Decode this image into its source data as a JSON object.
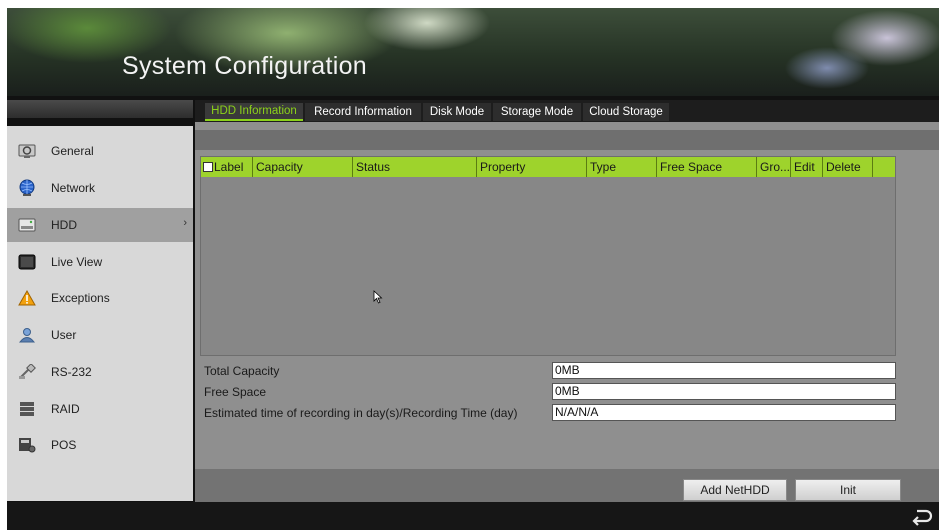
{
  "title": "System Configuration",
  "sidebar": {
    "items": [
      {
        "label": "General",
        "icon": "general-icon"
      },
      {
        "label": "Network",
        "icon": "network-icon"
      },
      {
        "label": "HDD",
        "icon": "hdd-icon",
        "active": true
      },
      {
        "label": "Live View",
        "icon": "live-view-icon"
      },
      {
        "label": "Exceptions",
        "icon": "warning-icon"
      },
      {
        "label": "User",
        "icon": "user-icon"
      },
      {
        "label": "RS-232",
        "icon": "rs232-icon"
      },
      {
        "label": "RAID",
        "icon": "raid-icon"
      },
      {
        "label": "POS",
        "icon": "pos-icon"
      }
    ],
    "active_arrow": "›"
  },
  "tabs": [
    {
      "label": "HDD Information",
      "active": true
    },
    {
      "label": "Record Information"
    },
    {
      "label": "Disk Mode"
    },
    {
      "label": "Storage Mode"
    },
    {
      "label": "Cloud Storage"
    }
  ],
  "table": {
    "columns": [
      "Label",
      "Capacity",
      "Status",
      "Property",
      "Type",
      "Free Space",
      "Gro...",
      "Edit",
      "Delete"
    ],
    "rows": []
  },
  "info": {
    "total_capacity_label": "Total Capacity",
    "total_capacity_value": "0MB",
    "free_space_label": "Free Space",
    "free_space_value": "0MB",
    "estimated_label": "Estimated time of recording in day(s)/Recording Time (day)",
    "estimated_value": "N/A/N/A"
  },
  "buttons": {
    "add_nethdd": "Add NetHDD",
    "init": "Init"
  },
  "colors": {
    "accent": "#9ed32c",
    "active_tab_text": "#8bd11a",
    "panel": "#8f8f8f",
    "sidebar": "#d8d8d8"
  }
}
